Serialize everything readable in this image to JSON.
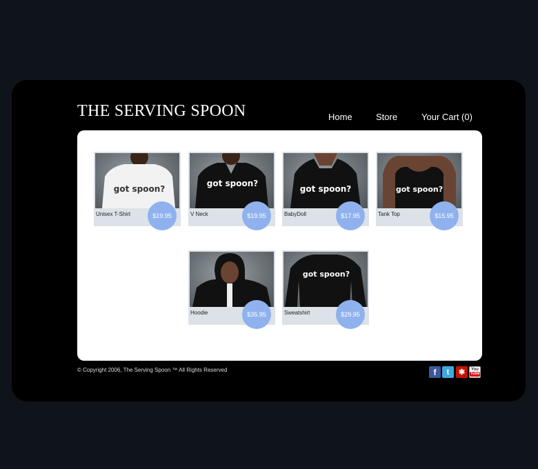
{
  "header": {
    "site_title": "THE SERVING SPOON",
    "nav": {
      "home": "Home",
      "store": "Store",
      "cart": "Your Cart (0)"
    }
  },
  "products": [
    {
      "name": "Unisex T-Shirt",
      "price": "$19.95",
      "shirt_color": "#f2f2f2",
      "text_color": "#333"
    },
    {
      "name": "V Neck",
      "price": "$19.95",
      "shirt_color": "#111",
      "text_color": "#fff"
    },
    {
      "name": "BabyDoll",
      "price": "$17.95",
      "shirt_color": "#111",
      "text_color": "#fff"
    },
    {
      "name": "Tank Top",
      "price": "$15.95",
      "shirt_color": "#111",
      "text_color": "#fff"
    },
    {
      "name": "Hoodie",
      "price": "$35.95",
      "shirt_color": "#111",
      "text_color": "#fff"
    },
    {
      "name": "Sweatshirt",
      "price": "$29.95",
      "shirt_color": "#111",
      "text_color": "#fff"
    }
  ],
  "shirt_print": "got spoon?",
  "footer": {
    "copyright": "© Copyright 2006, The Serving Spoon ™ All Rights Reserved"
  },
  "social": [
    {
      "name": "facebook",
      "glyph": "f"
    },
    {
      "name": "twitter",
      "glyph": "t"
    },
    {
      "name": "yelp",
      "glyph": "✱"
    },
    {
      "name": "youtube",
      "glyph_top": "You",
      "glyph_bottom": "Tube"
    }
  ],
  "colors": {
    "price_badge": "#8fb2ee",
    "frame": "#000000",
    "page_bg": "#0e1419"
  }
}
